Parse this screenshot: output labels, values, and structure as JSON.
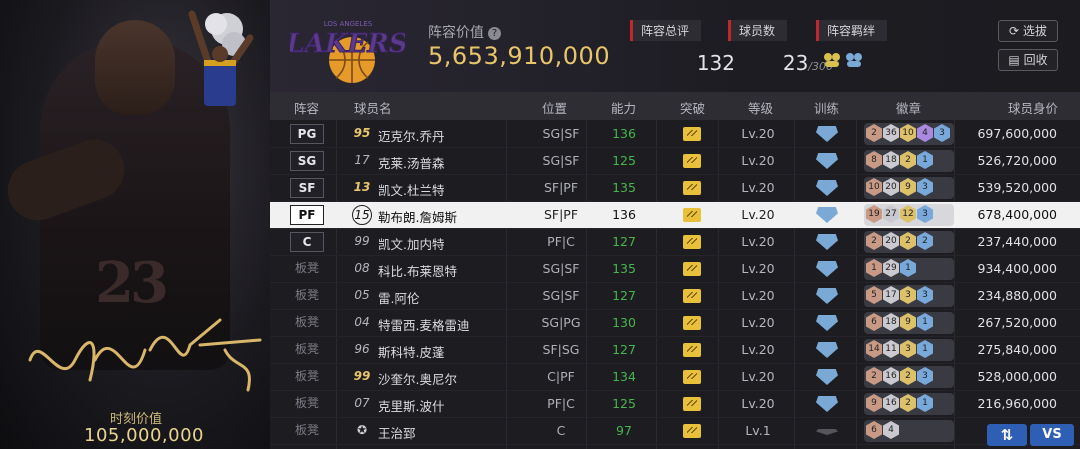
{
  "card": {
    "market_label": "时刻价值",
    "market_value": "105,000,000",
    "jersey_number": "23",
    "mini_jersey_team": "JAMES",
    "mini_jersey_number": "23",
    "signature": "Lebron 23"
  },
  "header": {
    "team_logo_text": "LOS ANGELES LAKERS",
    "team_value_label": "阵容价值",
    "team_value": "5,653,910,000",
    "stats": [
      {
        "label": "阵容总评",
        "value": "132"
      },
      {
        "label": "球员数",
        "value": "23",
        "suffix": "/300"
      },
      {
        "label": "阵容羁绊"
      }
    ],
    "bond_icons": [
      "bond-icon-gold",
      "bond-icon-blue"
    ],
    "buttons": {
      "pick": "选拔",
      "recycle": "回收"
    }
  },
  "table": {
    "columns": [
      "阵容",
      "球员名",
      "位置",
      "能力",
      "突破",
      "等级",
      "训练",
      "徽章",
      "球员身价"
    ],
    "rows": [
      {
        "slot": "PG",
        "num": "95",
        "name": "迈克尔.乔丹",
        "pos": "SG|SF",
        "ability": "136",
        "level": "Lv.20",
        "badges": [
          {
            "v": "2",
            "t": "br"
          },
          {
            "v": "36",
            "t": "sv"
          },
          {
            "v": "10",
            "t": "gd"
          },
          {
            "v": "4",
            "t": "pu"
          },
          {
            "v": "3",
            "t": "bl"
          }
        ],
        "value": "697,600,000"
      },
      {
        "slot": "SG",
        "num": "17",
        "name": "克莱.汤普森",
        "pos": "SG|SF",
        "ability": "125",
        "level": "Lv.20",
        "badges": [
          {
            "v": "8",
            "t": "br"
          },
          {
            "v": "18",
            "t": "sv"
          },
          {
            "v": "2",
            "t": "gd"
          },
          {
            "v": "1",
            "t": "bl"
          }
        ],
        "value": "526,720,000"
      },
      {
        "slot": "SF",
        "num": "13",
        "name": "凯文.杜兰特",
        "pos": "SF|PF",
        "ability": "135",
        "level": "Lv.20",
        "badges": [
          {
            "v": "10",
            "t": "br"
          },
          {
            "v": "20",
            "t": "sv"
          },
          {
            "v": "9",
            "t": "gd"
          },
          {
            "v": "3",
            "t": "bl"
          }
        ],
        "value": "539,520,000"
      },
      {
        "slot": "PF",
        "num": "15",
        "name": "勒布朗.詹姆斯",
        "pos": "SF|PF",
        "ability": "136",
        "level": "Lv.20",
        "badges": [
          {
            "v": "19",
            "t": "br"
          },
          {
            "v": "27",
            "t": "sv"
          },
          {
            "v": "12",
            "t": "gd"
          },
          {
            "v": "3",
            "t": "bl"
          }
        ],
        "value": "678,400,000"
      },
      {
        "slot": "C",
        "num": "99",
        "name": "凯文.加内特",
        "pos": "PF|C",
        "ability": "127",
        "level": "Lv.20",
        "badges": [
          {
            "v": "2",
            "t": "br"
          },
          {
            "v": "20",
            "t": "sv"
          },
          {
            "v": "2",
            "t": "gd"
          },
          {
            "v": "2",
            "t": "bl"
          }
        ],
        "value": "237,440,000"
      },
      {
        "slot": "板凳",
        "num": "08",
        "name": "科比.布莱恩特",
        "pos": "SG|SF",
        "ability": "135",
        "level": "Lv.20",
        "badges": [
          {
            "v": "1",
            "t": "br"
          },
          {
            "v": "29",
            "t": "sv"
          },
          {
            "v": "1",
            "t": "bl"
          }
        ],
        "value": "934,400,000"
      },
      {
        "slot": "板凳",
        "num": "05",
        "name": "雷.阿伦",
        "pos": "SG|SF",
        "ability": "127",
        "level": "Lv.20",
        "badges": [
          {
            "v": "5",
            "t": "br"
          },
          {
            "v": "17",
            "t": "sv"
          },
          {
            "v": "3",
            "t": "gd"
          },
          {
            "v": "3",
            "t": "bl"
          }
        ],
        "value": "234,880,000"
      },
      {
        "slot": "板凳",
        "num": "04",
        "name": "特雷西.麦格雷迪",
        "pos": "SG|PG",
        "ability": "130",
        "level": "Lv.20",
        "badges": [
          {
            "v": "6",
            "t": "br"
          },
          {
            "v": "18",
            "t": "sv"
          },
          {
            "v": "9",
            "t": "gd"
          },
          {
            "v": "1",
            "t": "bl"
          }
        ],
        "value": "267,520,000"
      },
      {
        "slot": "板凳",
        "num": "96",
        "name": "斯科特.皮蓬",
        "pos": "SF|SG",
        "ability": "127",
        "level": "Lv.20",
        "badges": [
          {
            "v": "14",
            "t": "br"
          },
          {
            "v": "11",
            "t": "sv"
          },
          {
            "v": "3",
            "t": "gd"
          },
          {
            "v": "1",
            "t": "bl"
          }
        ],
        "value": "275,840,000"
      },
      {
        "slot": "板凳",
        "num": "99",
        "name": "沙奎尔.奥尼尔",
        "pos": "C|PF",
        "ability": "134",
        "level": "Lv.20",
        "badges": [
          {
            "v": "2",
            "t": "br"
          },
          {
            "v": "16",
            "t": "sv"
          },
          {
            "v": "2",
            "t": "gd"
          },
          {
            "v": "3",
            "t": "bl"
          }
        ],
        "value": "528,000,000"
      },
      {
        "slot": "板凳",
        "num": "07",
        "name": "克里斯.波什",
        "pos": "PF|C",
        "ability": "125",
        "level": "Lv.20",
        "badges": [
          {
            "v": "9",
            "t": "br"
          },
          {
            "v": "16",
            "t": "sv"
          },
          {
            "v": "2",
            "t": "gd"
          },
          {
            "v": "1",
            "t": "bl"
          }
        ],
        "value": "216,960,000"
      },
      {
        "slot": "板凳",
        "num": "",
        "name": "王治郅",
        "pos": "C",
        "ability": "97",
        "level": "Lv.1",
        "badges": [
          {
            "v": "6",
            "t": "br"
          },
          {
            "v": "4",
            "t": "sv"
          }
        ],
        "value": ""
      }
    ]
  },
  "bottom_buttons": {
    "swap": "⇅",
    "vs": "VS"
  },
  "colors": {
    "gold": "#e8c46a",
    "green": "#46b54e",
    "accent_red": "#c0282d",
    "button_blue": "#2f5fb4"
  }
}
